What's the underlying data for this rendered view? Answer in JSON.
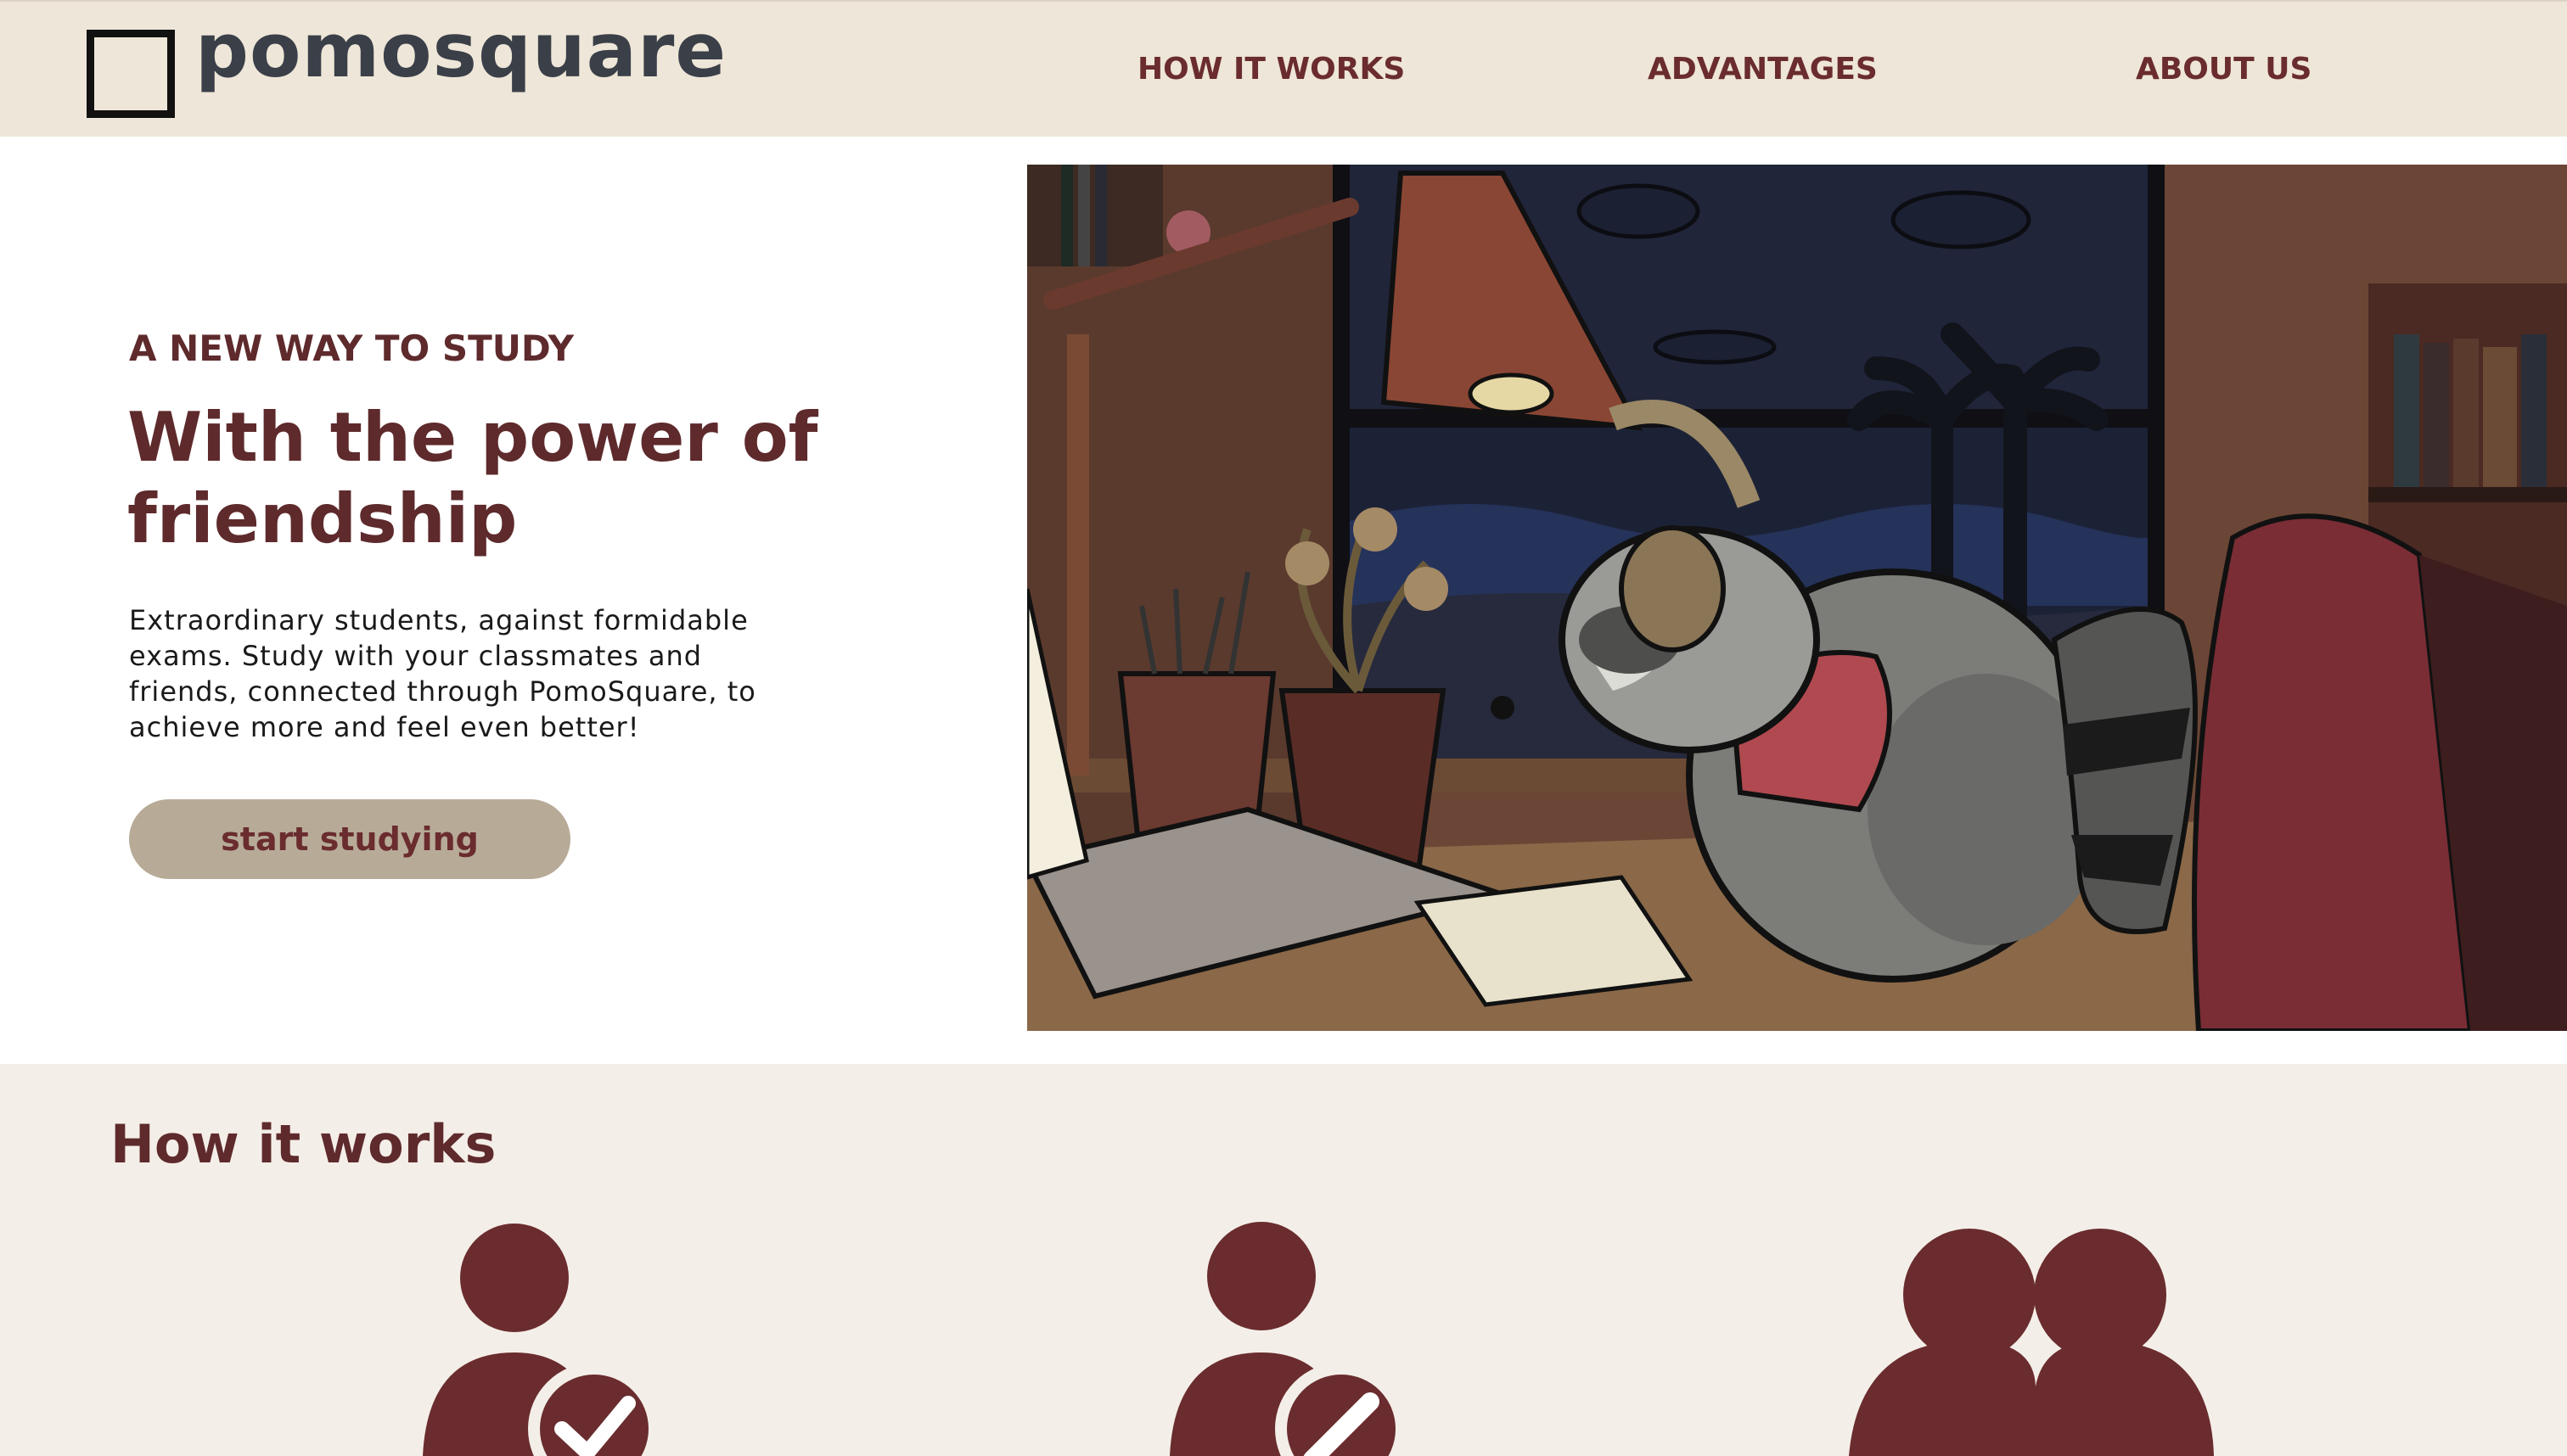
{
  "header": {
    "brand": "pomosquare",
    "nav": [
      {
        "label": "HOW IT WORKS"
      },
      {
        "label": "ADVANTAGES"
      },
      {
        "label": "ABOUT US"
      }
    ]
  },
  "hero": {
    "eyebrow": "A NEW WAY TO STUDY",
    "title": "With the power of friendship",
    "body": "Extraordinary students, against formidable exams. Study with your classmates and friends, connected through PomoSquare, to achieve more and feel even better!",
    "cta_label": "start studying"
  },
  "how_it_works": {
    "title": "How it works",
    "icons": [
      "user-check-icon",
      "user-edit-icon",
      "users-group-icon"
    ]
  },
  "colors": {
    "header_bg": "#eee6d8",
    "section_bg": "#f4eee8",
    "brand_maroon": "#6a2c2e",
    "cta_bg": "#b7ab98",
    "logo_text": "#3a3f48"
  }
}
